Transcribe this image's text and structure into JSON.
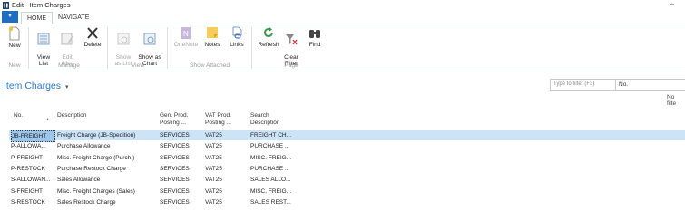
{
  "window": {
    "title": "Edit - Item Charges",
    "minimize_label": "–"
  },
  "tabs": {
    "app_menu": "▾",
    "items": [
      {
        "label": "HOME",
        "active": true
      },
      {
        "label": "NAVIGATE",
        "active": false
      }
    ]
  },
  "ribbon": {
    "new_label": "New",
    "view_list_label": "View\nList",
    "edit_list_label": "Edit\nList",
    "delete_label": "Delete",
    "show_as_list_label": "Show\nas List",
    "show_as_chart_label": "Show as\nChart",
    "onenote_label": "OneNote",
    "notes_label": "Notes",
    "links_label": "Links",
    "refresh_label": "Refresh",
    "clear_filter_label": "Clear\nFilter",
    "find_label": "Find",
    "groups": {
      "new": "New",
      "manage": "Manage",
      "view": "View",
      "show_attached": "Show Attached",
      "page": "Page"
    }
  },
  "page": {
    "title": "Item Charges",
    "title_chevron": "▾",
    "filter_placeholder": "Type to filter (F3)",
    "filter_field": "No.",
    "no_filter": "No filte"
  },
  "table": {
    "headers": {
      "no": "No.",
      "description": "Description",
      "gen_prod": "Gen. Prod.\nPosting ...",
      "vat_prod": "VAT Prod.\nPosting ...",
      "search": "Search\nDescription",
      "sort_indicator": "▲"
    },
    "rows": [
      {
        "no": "JB-FREIGHT",
        "description": "Freight Charge (JB-Spedition)",
        "gen_prod": "SERVICES",
        "vat_prod": "VAT25",
        "search": "FREIGHT CH...",
        "selected": true
      },
      {
        "no": "P-ALLOWA...",
        "description": "Purchase Allowance",
        "gen_prod": "SERVICES",
        "vat_prod": "VAT25",
        "search": "PURCHASE ..."
      },
      {
        "no": "P-FREIGHT",
        "description": "Misc. Freight Charge (Purch.)",
        "gen_prod": "SERVICES",
        "vat_prod": "VAT25",
        "search": "MISC. FREIG..."
      },
      {
        "no": "P-RESTOCK",
        "description": "Purchase Restock Charge",
        "gen_prod": "SERVICES",
        "vat_prod": "VAT25",
        "search": "PURCHASE ..."
      },
      {
        "no": "S-ALLOWAN...",
        "description": "Sales Allowance",
        "gen_prod": "SERVICES",
        "vat_prod": "VAT25",
        "search": "SALES ALLO..."
      },
      {
        "no": "S-FREIGHT",
        "description": "Misc. Freight Charges (Sales)",
        "gen_prod": "SERVICES",
        "vat_prod": "VAT25",
        "search": "MISC. FREIG..."
      },
      {
        "no": "S-RESTOCK",
        "description": "Sales Restock Charge",
        "gen_prod": "SERVICES",
        "vat_prod": "VAT25",
        "search": "SALES REST..."
      }
    ]
  }
}
